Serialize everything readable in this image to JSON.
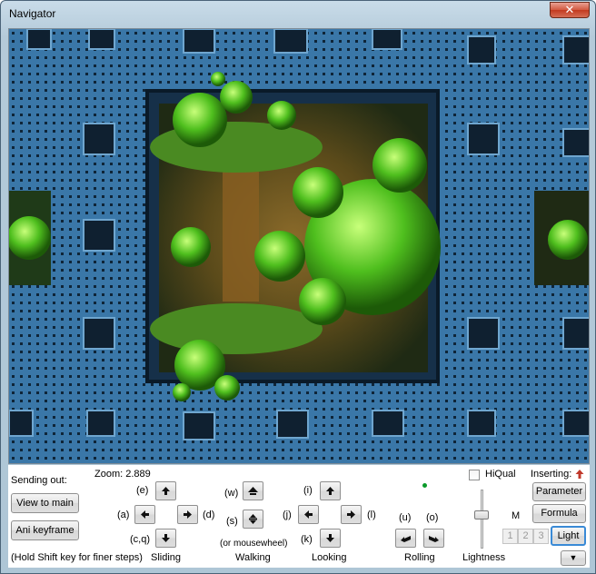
{
  "window": {
    "title": "Navigator",
    "close_glyph": "✕"
  },
  "viewport": {
    "description_icon": "fractal-render-view"
  },
  "panel": {
    "sending_out": "Sending out:",
    "view_to_main": "View to main",
    "ani_keyframe": "Ani keyframe",
    "hint": "(Hold Shift key for finer steps)",
    "zoom": "Zoom: 2.889",
    "sliding": {
      "label": "Sliding",
      "key_up": "(e)",
      "key_left": "(a)",
      "key_right": "(d)",
      "key_down": "(c,q)"
    },
    "walking": {
      "label": "Walking",
      "key_up": "(w)",
      "key_down": "(s)",
      "hint": "(or mousewheel)"
    },
    "looking": {
      "label": "Looking",
      "key_up": "(i)",
      "key_left": "(j)",
      "key_right": "(l)",
      "key_down": "(k)"
    },
    "rolling": {
      "label": "Rolling",
      "key_left": "(u)",
      "key_right": "(o)"
    },
    "lightness": {
      "label": "Lightness",
      "marker": "M"
    },
    "hiqual": "HiQual",
    "inserting": "Inserting:",
    "parameter": "Parameter",
    "formula": "Formula",
    "light": "Light",
    "num_buttons": [
      "1",
      "2",
      "3"
    ],
    "expand_glyph": "▼"
  },
  "colors": {
    "accent_green": "#0a9a2a",
    "inserting_arrow": "#c0392b"
  }
}
